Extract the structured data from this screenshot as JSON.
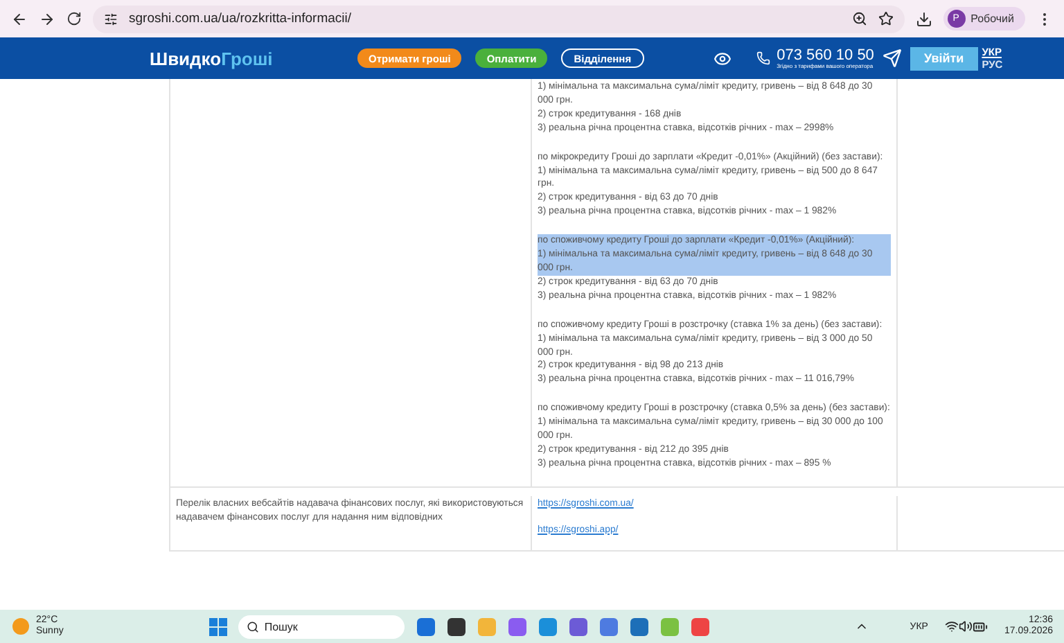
{
  "browser": {
    "url": "sgroshi.com.ua/ua/rozkritta-informacii/",
    "profile_initial": "Р",
    "profile_name": "Робочий"
  },
  "header": {
    "logo": {
      "first": "Швидко",
      "second": "Гроші"
    },
    "buttons": [
      {
        "label": "Отримати гроші",
        "kind": "orange"
      },
      {
        "label": "Оплатити",
        "kind": "green"
      },
      {
        "label": "Відділення",
        "kind": "outline"
      }
    ],
    "phone": "073 560 10 50",
    "phone_note": "Згідно з тарифами вашого оператора",
    "login": "Увійти",
    "languages": [
      {
        "label": "УКР",
        "selected": true
      },
      {
        "label": "РУС",
        "selected": false
      }
    ]
  },
  "table": {
    "rows": [
      {
        "label": "",
        "blocks": [
          {
            "lines": [
              {
                "text": "1) мінімальна та максимальна сума/ліміт кредиту, гривень – від 8 648 до 30 000 грн.",
                "selected": false
              },
              {
                "text": "2) строк кредитування - 168 днів",
                "selected": false
              },
              {
                "text": "3) реальна річна процентна ставка, відсотків річних - max – 2998%",
                "selected": false
              }
            ]
          },
          {
            "lines": [
              {
                "text": "по мікрокредиту Гроші до зарплати «Кредит -0,01%» (Акційний) (без застави):",
                "selected": false
              },
              {
                "text": "1) мінімальна та максимальна сума/ліміт кредиту, гривень – від 500 до 8 647 грн.",
                "selected": false
              },
              {
                "text": "2) строк кредитування - від 63 до 70 днів",
                "selected": false
              },
              {
                "text": "3) реальна річна процентна ставка, відсотків річних - max – 1 982%",
                "selected": false
              }
            ]
          },
          {
            "lines": [
              {
                "text": "по споживчому кредиту Гроші до зарплати «Кредит -0,01%» (Акційний):",
                "selected": true
              },
              {
                "text": "1) мінімальна та максимальна сума/ліміт кредиту, гривень – від 8 648 до 30 000 грн.",
                "selected": true
              },
              {
                "text": "2) строк кредитування - від 63 до 70 днів",
                "selected": false
              },
              {
                "text": "3) реальна річна процентна ставка, відсотків річних - max – 1 982%",
                "selected": false
              }
            ]
          },
          {
            "lines": [
              {
                "text": "по споживчому кредиту Гроші в розстрочку (ставка 1% за день) (без застави):",
                "selected": false
              },
              {
                "text": "1) мінімальна та максимальна сума/ліміт кредиту, гривень – від 3 000 до 50 000 грн.",
                "selected": false
              },
              {
                "text": "2) строк кредитування - від 98 до 213 днів",
                "selected": false
              },
              {
                "text": "3) реальна річна процентна ставка, відсотків річних - max – 11 016,79%",
                "selected": false
              }
            ]
          },
          {
            "lines": [
              {
                "text": "по споживчому кредиту Гроші в розстрочку (ставка 0,5% за день) (без застави):",
                "selected": false
              },
              {
                "text": "1) мінімальна та максимальна сума/ліміт кредиту, гривень – від 30 000 до 100 000 грн.",
                "selected": false
              },
              {
                "text": "2) строк кредитування - від 212 до 395 днів",
                "selected": false
              },
              {
                "text": "3) реальна річна процентна ставка, відсотків річних - max – 895 %",
                "selected": false
              }
            ]
          }
        ],
        "links": []
      },
      {
        "label": "Перелік власних вебсайтів надавача фінансових послуг, які використовуються надавачем фінансових послуг для надання ним відповідних",
        "blocks": [],
        "links": [
          "https://sgroshi.com.ua/",
          "https://sgroshi.app/"
        ]
      }
    ]
  },
  "taskbar": {
    "temperature": "22°C",
    "weather": "Sunny",
    "search": "Пошук",
    "language": "УКР",
    "time": "12:36",
    "date": "17.09.2026"
  }
}
